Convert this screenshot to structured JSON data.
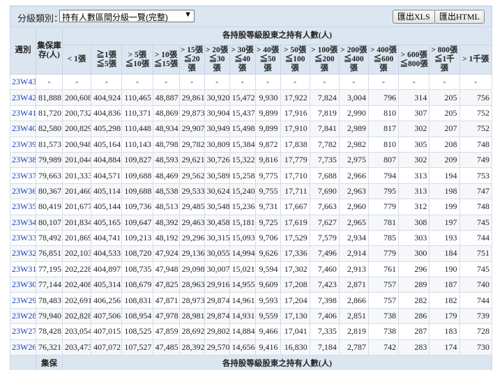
{
  "toolbar": {
    "category_label": "分級類別：",
    "category_value": "持有人數區間分級一覽(完整)",
    "xls_button": "匯出XLS",
    "html_button": "匯出HTML"
  },
  "table": {
    "week_header": "週別",
    "custody_header": "集保庫存(人)",
    "group_header": "各持股等級股東之持有人數(人)",
    "level_headers": [
      "< 1張",
      "≧1張 ≦5張",
      "> 5張 ≦10張",
      "> 10張 ≦15張",
      "> 15張 ≦20張",
      "> 20張 ≦30張",
      "> 30張 ≦40張",
      "> 40張 ≦50張",
      "> 50張 ≦100張",
      "> 100張 ≦200張",
      "> 200張 ≦400張",
      "> 400張 ≦600張",
      "> 600張 ≦800張",
      "> 800張 ≦1千張",
      "> 1千張"
    ],
    "rows": [
      {
        "week": "23W43",
        "values": [
          "-",
          "-",
          "-",
          "-",
          "-",
          "-",
          "-",
          "-",
          "-",
          "-",
          "-",
          "-",
          "-",
          "-",
          "-",
          "-"
        ]
      },
      {
        "week": "23W42",
        "values": [
          "81,888",
          "200,608",
          "404,924",
          "110,465",
          "48,887",
          "29,861",
          "30,920",
          "15,472",
          "9,930",
          "17,922",
          "7,824",
          "3,004",
          "796",
          "314",
          "205",
          "756"
        ]
      },
      {
        "week": "23W41",
        "values": [
          "81,720",
          "200,732",
          "404,836",
          "110,371",
          "48,869",
          "29,873",
          "30,904",
          "15,437",
          "9,899",
          "17,916",
          "7,819",
          "2,990",
          "810",
          "307",
          "205",
          "752"
        ]
      },
      {
        "week": "23W40",
        "values": [
          "82,580",
          "200,829",
          "405,298",
          "110,448",
          "48,934",
          "29,907",
          "30,949",
          "15,498",
          "9,899",
          "17,910",
          "7,841",
          "2,989",
          "817",
          "302",
          "207",
          "752"
        ]
      },
      {
        "week": "23W39",
        "values": [
          "81,573",
          "200,948",
          "405,164",
          "110,143",
          "48,798",
          "29,782",
          "30,809",
          "15,384",
          "9,872",
          "17,838",
          "7,782",
          "2,982",
          "810",
          "305",
          "208",
          "748"
        ]
      },
      {
        "week": "23W38",
        "values": [
          "79,989",
          "201,044",
          "404,884",
          "109,827",
          "48,593",
          "29,621",
          "30,726",
          "15,322",
          "9,816",
          "17,779",
          "7,735",
          "2,975",
          "807",
          "302",
          "209",
          "749"
        ]
      },
      {
        "week": "23W37",
        "values": [
          "79,663",
          "201,333",
          "404,571",
          "109,688",
          "48,469",
          "29,562",
          "30,589",
          "15,258",
          "9,775",
          "17,710",
          "7,688",
          "2,966",
          "794",
          "313",
          "194",
          "753"
        ]
      },
      {
        "week": "23W36",
        "values": [
          "80,367",
          "201,460",
          "405,114",
          "109,688",
          "48,538",
          "29,533",
          "30,624",
          "15,240",
          "9,755",
          "17,711",
          "7,690",
          "2,963",
          "795",
          "313",
          "198",
          "747"
        ]
      },
      {
        "week": "23W35",
        "values": [
          "80,419",
          "201,677",
          "405,144",
          "109,736",
          "48,513",
          "29,485",
          "30,548",
          "15,236",
          "9,731",
          "17,667",
          "7,663",
          "2,960",
          "779",
          "312",
          "199",
          "748"
        ]
      },
      {
        "week": "23W34",
        "values": [
          "80,107",
          "201,834",
          "405,165",
          "109,647",
          "48,392",
          "29,463",
          "30,458",
          "15,181",
          "9,725",
          "17,619",
          "7,627",
          "2,965",
          "781",
          "308",
          "197",
          "745"
        ]
      },
      {
        "week": "23W33",
        "values": [
          "78,492",
          "201,869",
          "404,741",
          "109,213",
          "48,192",
          "29,296",
          "30,315",
          "15,093",
          "9,706",
          "17,529",
          "7,579",
          "2,934",
          "785",
          "303",
          "193",
          "744"
        ]
      },
      {
        "week": "23W32",
        "values": [
          "76,851",
          "202,103",
          "404,533",
          "108,720",
          "47,924",
          "29,136",
          "30,055",
          "14,994",
          "9,626",
          "17,336",
          "7,496",
          "2,914",
          "779",
          "300",
          "184",
          "751"
        ]
      },
      {
        "week": "23W31",
        "values": [
          "77,195",
          "202,228",
          "404,897",
          "108,735",
          "47,948",
          "29,098",
          "30,007",
          "15,021",
          "9,594",
          "17,302",
          "7,460",
          "2,913",
          "761",
          "296",
          "190",
          "745"
        ]
      },
      {
        "week": "23W30",
        "values": [
          "77,144",
          "202,408",
          "405,314",
          "108,679",
          "47,825",
          "28,963",
          "29,916",
          "14,955",
          "9,609",
          "17,208",
          "7,423",
          "2,871",
          "757",
          "289",
          "187",
          "740"
        ]
      },
      {
        "week": "23W29",
        "values": [
          "78,483",
          "202,691",
          "406,256",
          "108,831",
          "47,871",
          "28,973",
          "29,874",
          "14,961",
          "9,593",
          "17,204",
          "7,398",
          "2,866",
          "757",
          "282",
          "182",
          "744"
        ]
      },
      {
        "week": "23W28",
        "values": [
          "79,940",
          "202,828",
          "407,506",
          "108,954",
          "47,978",
          "28,981",
          "29,874",
          "14,931",
          "9,559",
          "17,130",
          "7,406",
          "2,851",
          "738",
          "286",
          "179",
          "739"
        ]
      },
      {
        "week": "23W27",
        "values": [
          "78,428",
          "203,054",
          "407,015",
          "108,525",
          "47,859",
          "28,692",
          "29,802",
          "14,884",
          "9,466",
          "17,041",
          "7,335",
          "2,819",
          "738",
          "287",
          "183",
          "728"
        ]
      },
      {
        "week": "23W26",
        "values": [
          "76,321",
          "203,473",
          "407,072",
          "107,527",
          "47,485",
          "28,392",
          "29,570",
          "14,656",
          "9,416",
          "16,830",
          "7,184",
          "2,787",
          "742",
          "283",
          "174",
          "730"
        ]
      }
    ],
    "footer_custody": "集保",
    "footer_group": "各持股等級股東之持有人數(人)"
  }
}
